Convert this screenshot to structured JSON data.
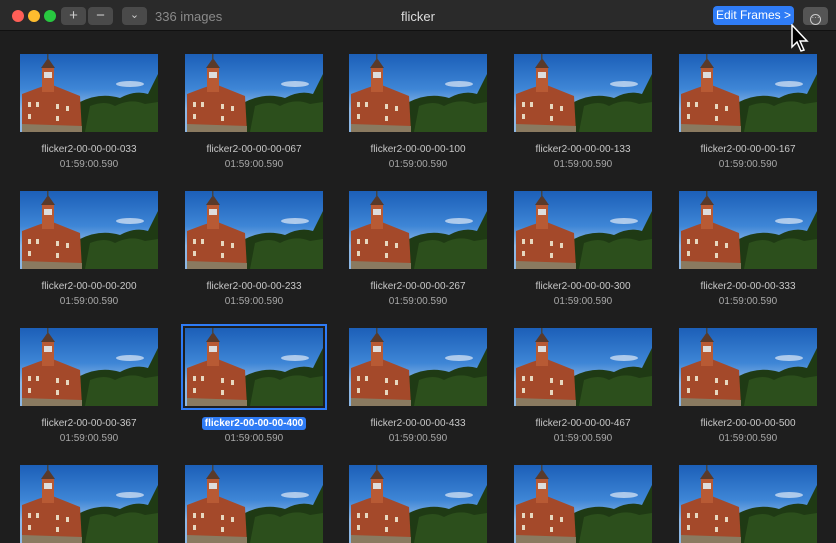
{
  "toolbar": {
    "add": "+",
    "remove": "−",
    "dropdown": "⌄",
    "count": "336 images",
    "title": "flicker",
    "edit_frames": "Edit Frames",
    "edit_chevron": ">",
    "more": "···"
  },
  "colors": {
    "accent": "#2f7cf6"
  },
  "items": [
    {
      "name": "flicker2-00-00-00-033",
      "time": "01:59:00.590"
    },
    {
      "name": "flicker2-00-00-00-067",
      "time": "01:59:00.590"
    },
    {
      "name": "flicker2-00-00-00-100",
      "time": "01:59:00.590"
    },
    {
      "name": "flicker2-00-00-00-133",
      "time": "01:59:00.590"
    },
    {
      "name": "flicker2-00-00-00-167",
      "time": "01:59:00.590"
    },
    {
      "name": "flicker2-00-00-00-200",
      "time": "01:59:00.590"
    },
    {
      "name": "flicker2-00-00-00-233",
      "time": "01:59:00.590"
    },
    {
      "name": "flicker2-00-00-00-267",
      "time": "01:59:00.590"
    },
    {
      "name": "flicker2-00-00-00-300",
      "time": "01:59:00.590"
    },
    {
      "name": "flicker2-00-00-00-333",
      "time": "01:59:00.590"
    },
    {
      "name": "flicker2-00-00-00-367",
      "time": "01:59:00.590"
    },
    {
      "name": "flicker2-00-00-00-400",
      "time": "01:59:00.590",
      "selected": true
    },
    {
      "name": "flicker2-00-00-00-433",
      "time": "01:59:00.590"
    },
    {
      "name": "flicker2-00-00-00-467",
      "time": "01:59:00.590"
    },
    {
      "name": "flicker2-00-00-00-500",
      "time": "01:59:00.590"
    }
  ]
}
